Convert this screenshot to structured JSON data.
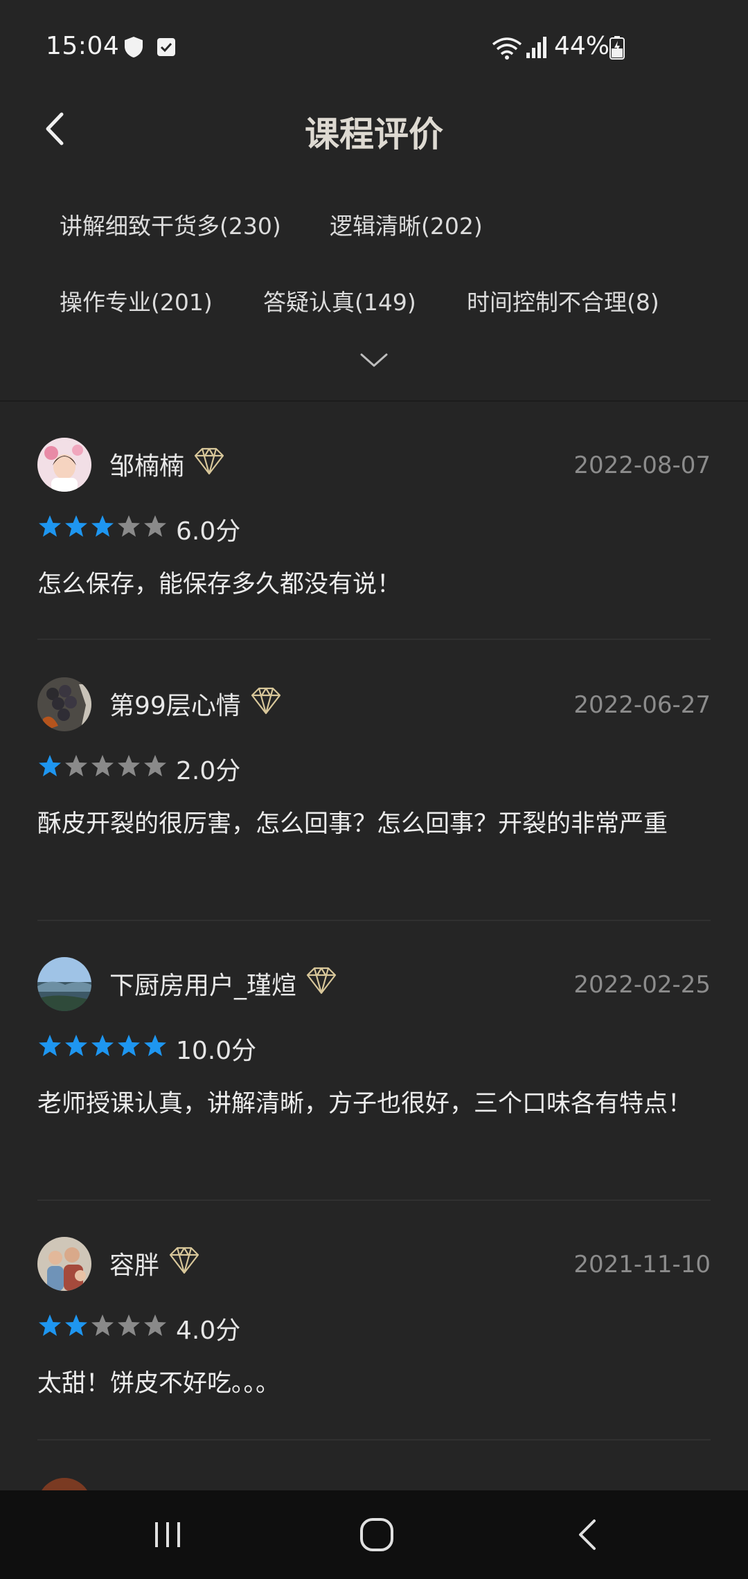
{
  "status_bar": {
    "time": "15:04",
    "battery_percent": "44%",
    "icons": [
      "shield-icon",
      "checkbox-icon",
      "wifi-icon",
      "signal-icon",
      "battery-charging-icon"
    ]
  },
  "header": {
    "title": "课程评价",
    "back_icon": "chevron-left-icon"
  },
  "tags": [
    {
      "label": "讲解细致干货多(230)"
    },
    {
      "label": "逻辑清晰(202)"
    },
    {
      "label": "操作专业(201)"
    },
    {
      "label": "答疑认真(149)"
    },
    {
      "label": "时间控制不合理(8)"
    }
  ],
  "expand_icon": "chevron-down-icon",
  "colors": {
    "background": "#252525",
    "star_active": "#1e96f0",
    "star_inactive": "#8a8a8a",
    "date": "#8c8c8c",
    "title": "#dedad2"
  },
  "reviews": [
    {
      "username": "邹楠楠",
      "date": "2022-08-07",
      "rating": 3,
      "score": "6.0分",
      "text": "怎么保存，能保存多久都没有说！"
    },
    {
      "username": "第99层心情",
      "date": "2022-06-27",
      "rating": 1,
      "score": "2.0分",
      "text": "酥皮开裂的很厉害，怎么回事？怎么回事？开裂的非常严重"
    },
    {
      "username": "下厨房用户_瑾煊",
      "date": "2022-02-25",
      "rating": 5,
      "score": "10.0分",
      "text": "老师授课认真，讲解清晰，方子也很好，三个口味各有特点！"
    },
    {
      "username": "容胖",
      "date": "2021-11-10",
      "rating": 2,
      "score": "4.0分",
      "text": "太甜！饼皮不好吃。。。"
    }
  ],
  "nav_bar": {
    "icons": [
      "recent-apps-icon",
      "home-icon",
      "back-icon"
    ]
  }
}
